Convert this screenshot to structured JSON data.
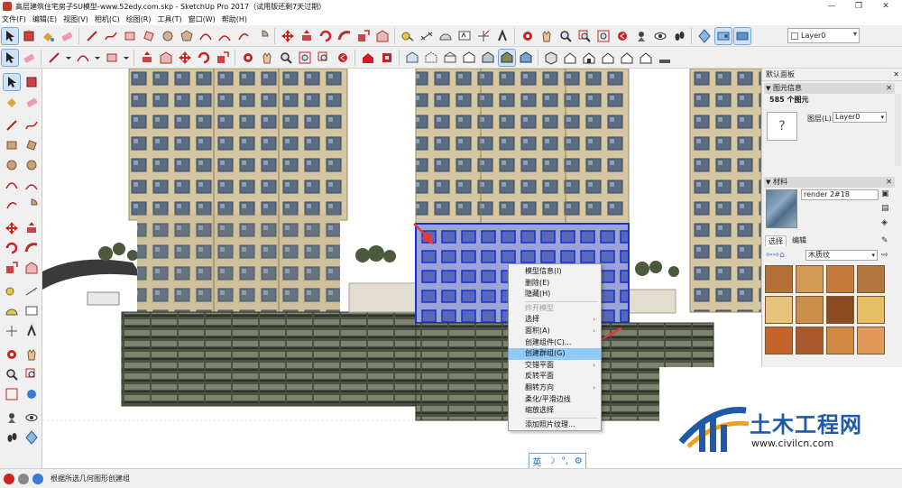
{
  "window": {
    "title": "高层建筑住宅房子SU模型-www.52edy.com.skp - SketchUp Pro 2017（试用版还剩7天过期）",
    "minimize": "—",
    "maximize": "❐",
    "close": "✕"
  },
  "menu": [
    "文件(F)",
    "编辑(E)",
    "视图(V)",
    "相机(C)",
    "绘图(R)",
    "工具(T)",
    "窗口(W)",
    "帮助(H)"
  ],
  "toolbar": {
    "layer_value": "Layer0"
  },
  "context_menu": {
    "items": [
      {
        "label": "模型信息(I)",
        "disabled": false,
        "submenu": false,
        "highlighted": false
      },
      {
        "label": "删除(E)",
        "disabled": false,
        "submenu": false,
        "highlighted": false
      },
      {
        "label": "隐藏(H)",
        "disabled": false,
        "submenu": false,
        "highlighted": false
      },
      {
        "sep": true
      },
      {
        "label": "炸开模型",
        "disabled": true,
        "submenu": false,
        "highlighted": false
      },
      {
        "label": "选择",
        "disabled": false,
        "submenu": true,
        "highlighted": false
      },
      {
        "label": "面积(A)",
        "disabled": false,
        "submenu": true,
        "highlighted": false
      },
      {
        "label": "创建组件(C)...",
        "disabled": false,
        "submenu": false,
        "highlighted": false
      },
      {
        "label": "创建群组(G)",
        "disabled": false,
        "submenu": false,
        "highlighted": true
      },
      {
        "label": "交错平面",
        "disabled": false,
        "submenu": true,
        "highlighted": false
      },
      {
        "label": "反转平面",
        "disabled": false,
        "submenu": false,
        "highlighted": false
      },
      {
        "label": "翻转方向",
        "disabled": false,
        "submenu": true,
        "highlighted": false
      },
      {
        "label": "柔化/平滑边线",
        "disabled": false,
        "submenu": false,
        "highlighted": false
      },
      {
        "label": "缩放选择",
        "disabled": false,
        "submenu": false,
        "highlighted": false
      },
      {
        "sep": true
      },
      {
        "label": "添加照片纹理...",
        "disabled": false,
        "submenu": false,
        "highlighted": false
      }
    ]
  },
  "ime": {
    "lang": "英",
    "moon": "☽",
    "dot": "°,",
    "gear": "⚙"
  },
  "panel": {
    "title": "默认面板",
    "entity_info": {
      "header": "图元信息",
      "count": "585 个图元",
      "layer_label": "图层(L):",
      "layer_value": "Layer0",
      "unknown_glyph": "?"
    },
    "materials": {
      "header": "材料",
      "name": "render 2#18",
      "tabs": [
        "选择",
        "编辑"
      ],
      "category": "木质纹"
    }
  },
  "status": {
    "text": "根据所选几何图形创建组"
  },
  "watermark": {
    "cn": "土木工程网",
    "url": "www.civilcn.com"
  },
  "colors": {
    "selection": "#1a2fd6",
    "highlight": "#91c9f7",
    "arrow": "#e23b3b",
    "brand": "#1f5aa6"
  }
}
